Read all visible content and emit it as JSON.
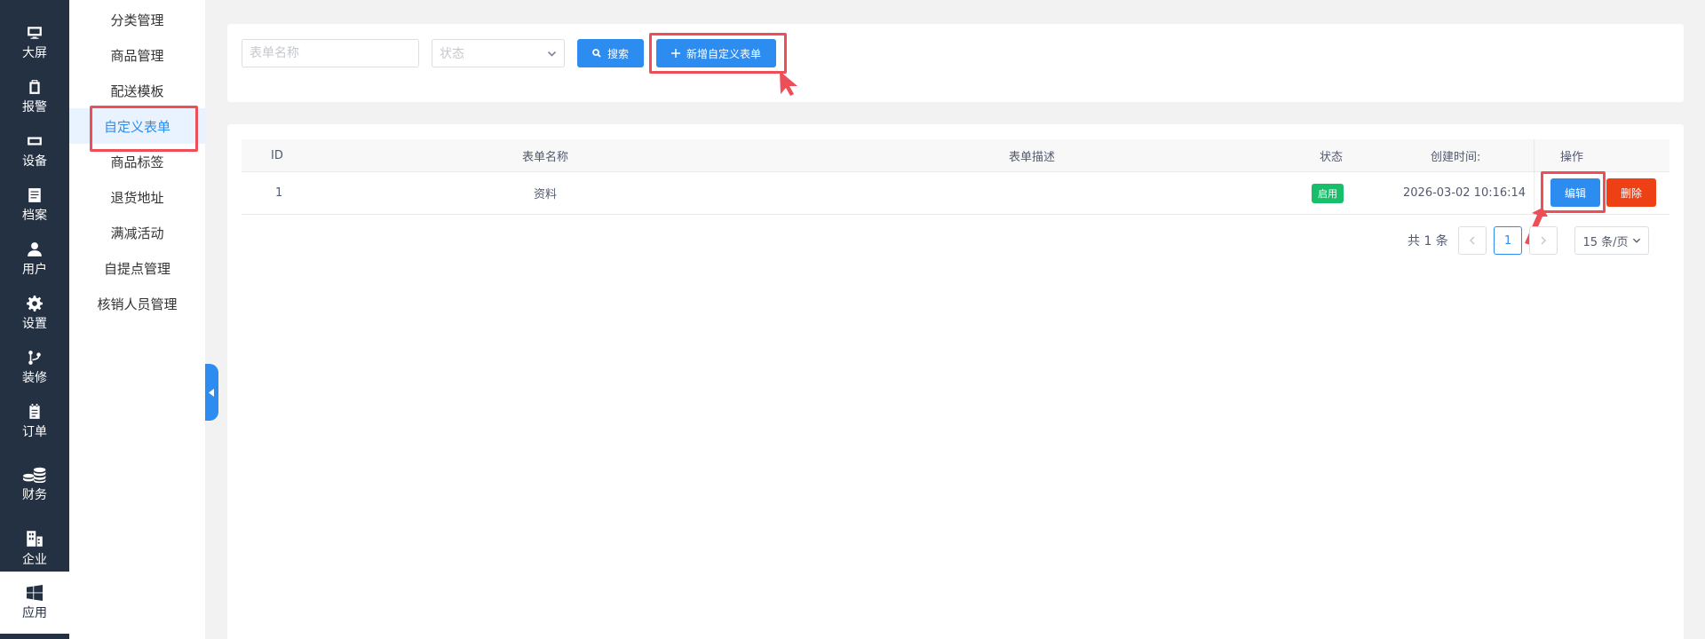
{
  "rail": {
    "items": [
      {
        "label": "大屏",
        "icon": "monitor-icon"
      },
      {
        "label": "报警",
        "icon": "clipboard-icon"
      },
      {
        "label": "设备",
        "icon": "device-icon"
      },
      {
        "label": "档案",
        "icon": "document-icon"
      },
      {
        "label": "用户",
        "icon": "user-icon"
      },
      {
        "label": "设置",
        "icon": "gear-icon"
      },
      {
        "label": "装修",
        "icon": "branch-icon"
      },
      {
        "label": "订单",
        "icon": "order-icon"
      },
      {
        "label": "财务",
        "icon": "coins-icon"
      },
      {
        "label": "企业",
        "icon": "building-icon"
      },
      {
        "label": "应用",
        "icon": "windows-icon"
      }
    ],
    "active_label": "应用"
  },
  "submenu": {
    "items": [
      "分类管理",
      "商品管理",
      "配送模板",
      "自定义表单",
      "商品标签",
      "退货地址",
      "满减活动",
      "自提点管理",
      "核销人员管理"
    ],
    "active": "自定义表单"
  },
  "search": {
    "name_placeholder": "表单名称",
    "status_placeholder": "状态",
    "search_label": "搜索",
    "add_label": "新增自定义表单"
  },
  "table": {
    "columns": [
      "ID",
      "表单名称",
      "表单描述",
      "状态",
      "创建时间:",
      "操作"
    ],
    "rows": [
      {
        "id": "1",
        "name": "资料",
        "desc": "",
        "status": "启用",
        "created": "2026-03-02 10:16:14",
        "edit_label": "编辑",
        "delete_label": "删除"
      }
    ]
  },
  "pagination": {
    "total_text": "共 1 条",
    "current_page": "1",
    "page_size": "15 条/页"
  },
  "colors": {
    "rail_bg": "#233142",
    "primary": "#2d8cf0",
    "danger": "#ed4014",
    "success": "#19be6b",
    "highlight": "#ed4e58"
  }
}
